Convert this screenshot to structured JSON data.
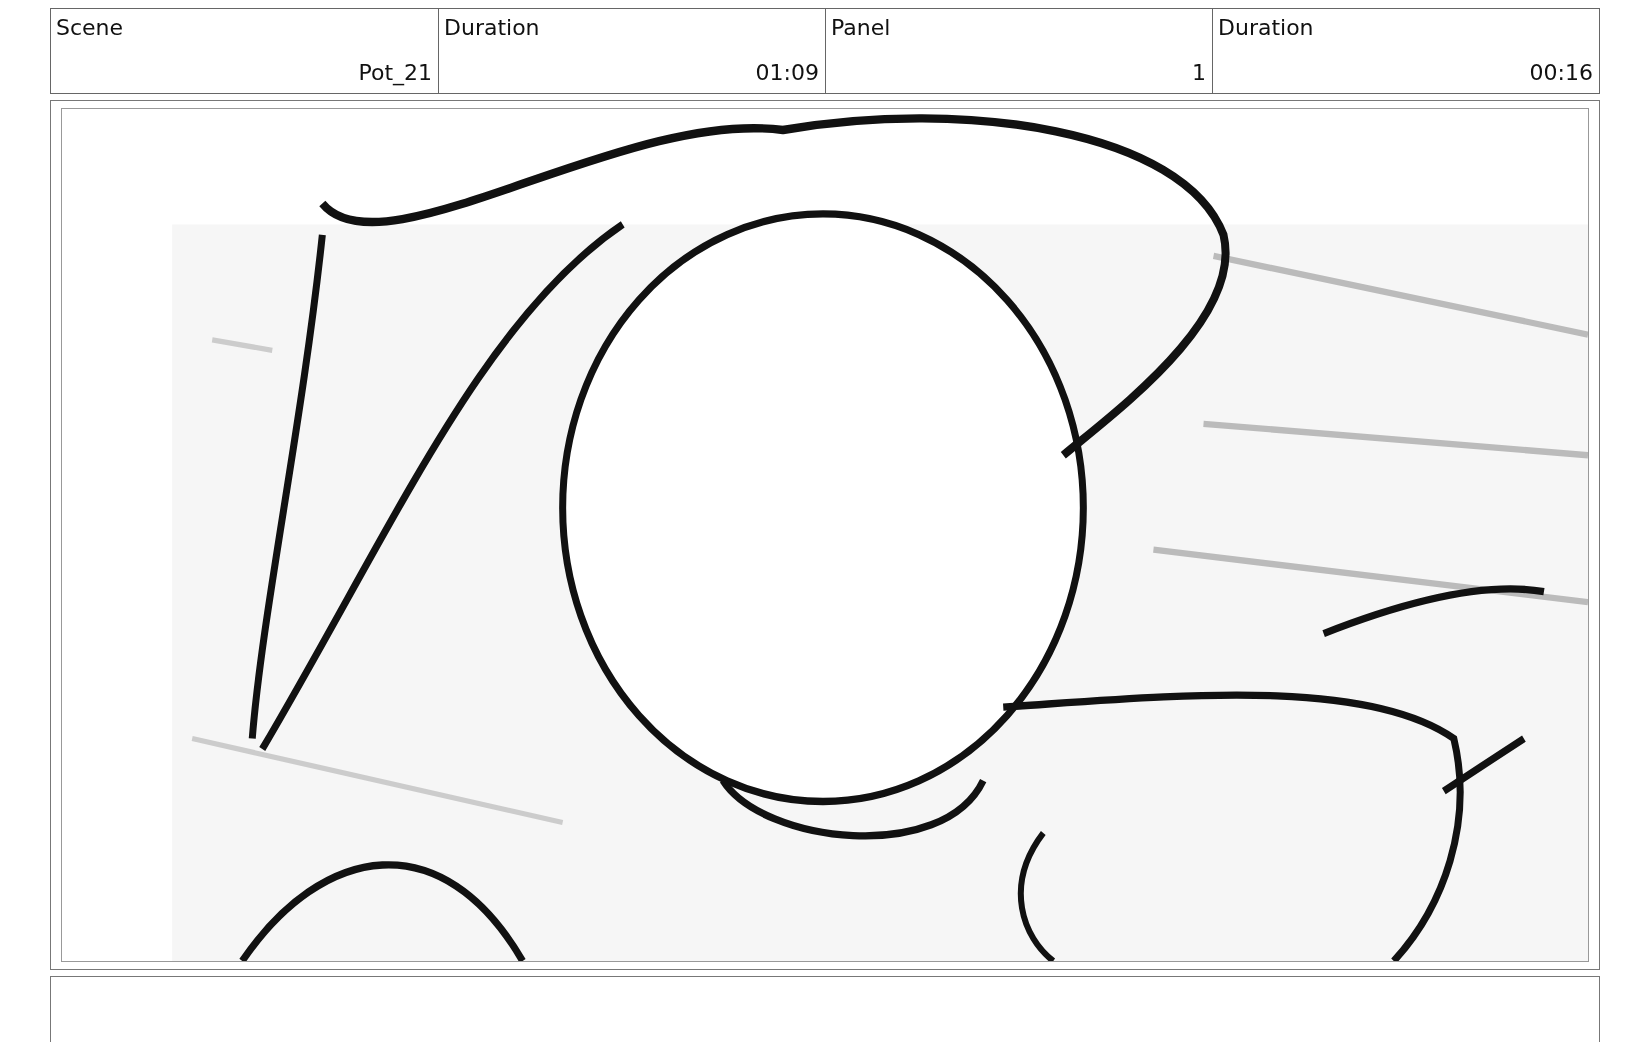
{
  "header": {
    "labels": [
      "Scene",
      "Duration",
      "Panel",
      "Duration"
    ],
    "values": [
      "Pot_21",
      "01:09",
      "1",
      "00:16"
    ]
  }
}
